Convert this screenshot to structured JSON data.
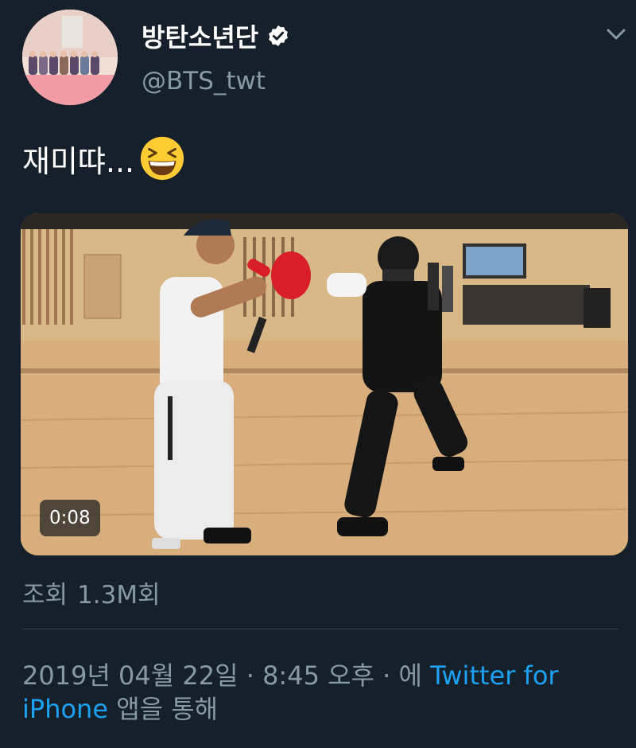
{
  "user": {
    "display_name": "방탄소년단",
    "handle": "@BTS_twt",
    "verified_icon": "verified-badge-icon"
  },
  "tweet": {
    "text": "재미땨...",
    "emoji": "grinning-squinting-face-emoji"
  },
  "media": {
    "duration": "0:08"
  },
  "stats": {
    "views_prefix": "조회",
    "views_value": "1.3M회"
  },
  "meta": {
    "date": "2019년 04월 22일",
    "sep1": " · ",
    "time": "8:45 오후",
    "sep2": " · ",
    "via_prefix": "에 ",
    "source_part1": "Twitter for",
    "source_part2": "iPhone",
    "via_suffix": " 앱을 통해"
  },
  "colors": {
    "background": "#15202b",
    "secondary_text": "#8899a6",
    "link": "#1da1f2"
  }
}
